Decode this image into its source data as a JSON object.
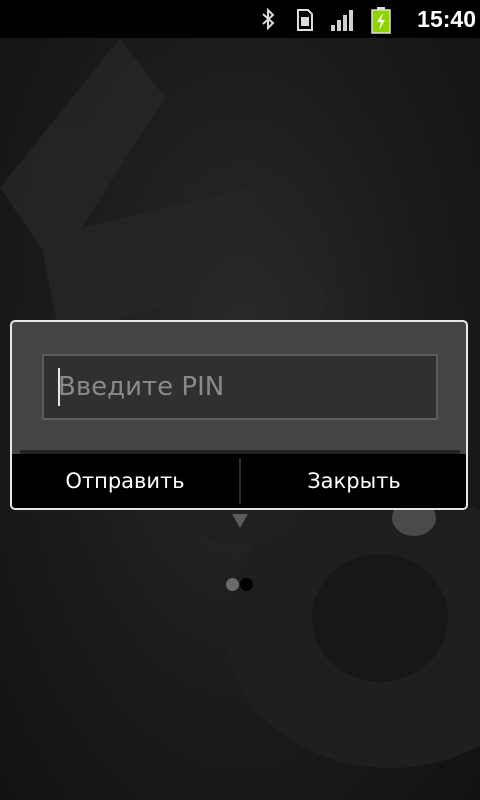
{
  "status_bar": {
    "time": "15:40",
    "icons": [
      "bluetooth-icon",
      "sim-card-icon",
      "signal-icon",
      "battery-charging-icon"
    ],
    "battery_color": "#8fd400"
  },
  "dialog": {
    "input": {
      "value": "",
      "placeholder": "Введите PIN"
    },
    "buttons": {
      "send_label": "Отправить",
      "close_label": "Закрыть"
    }
  },
  "lockscreen": {
    "page_count": 2,
    "active_page": 2
  }
}
